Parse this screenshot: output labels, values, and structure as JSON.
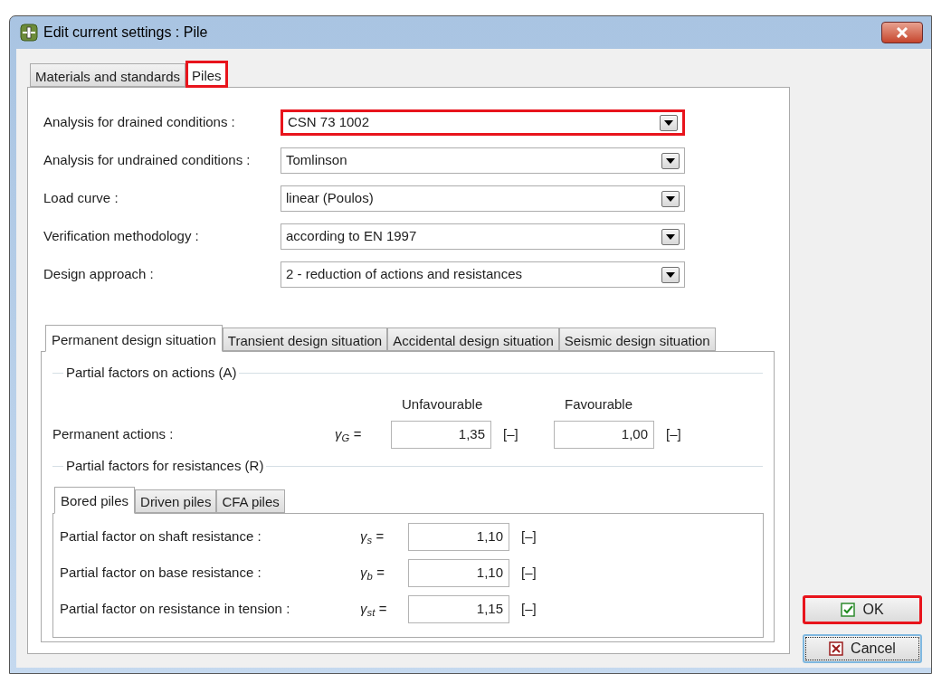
{
  "window": {
    "title": "Edit current settings : Pile"
  },
  "tabs": [
    {
      "label": "Materials and standards",
      "selected": false,
      "highlighted": false
    },
    {
      "label": "Piles",
      "selected": true,
      "highlighted": true
    }
  ],
  "settings": [
    {
      "label": "Analysis for drained conditions :",
      "value": "CSN 73 1002",
      "highlighted": true
    },
    {
      "label": "Analysis for undrained conditions :",
      "value": "Tomlinson",
      "highlighted": false
    },
    {
      "label": "Load curve :",
      "value": "linear (Poulos)",
      "highlighted": false
    },
    {
      "label": "Verification methodology :",
      "value": "according to EN 1997",
      "highlighted": false
    },
    {
      "label": "Design approach :",
      "value": "2 - reduction of actions and resistances",
      "highlighted": false
    }
  ],
  "situation_tabs": [
    {
      "label": "Permanent design situation",
      "selected": true
    },
    {
      "label": "Transient design situation",
      "selected": false
    },
    {
      "label": "Accidental design situation",
      "selected": false
    },
    {
      "label": "Seismic design situation",
      "selected": false
    }
  ],
  "actions_group": {
    "title": "Partial factors on actions (A)",
    "columns": [
      "Unfavourable",
      "Favourable"
    ],
    "rows": [
      {
        "label": "Permanent actions :",
        "symbol": "γ$_{G}$ =",
        "values": [
          {
            "value": "1,35",
            "unit": "[–]"
          },
          {
            "value": "1,00",
            "unit": "[–]"
          }
        ]
      }
    ]
  },
  "resistances_group": {
    "title": "Partial factors for resistances (R)",
    "tabs": [
      {
        "label": "Bored piles",
        "selected": true
      },
      {
        "label": "Driven piles",
        "selected": false
      },
      {
        "label": "CFA piles",
        "selected": false
      }
    ],
    "rows": [
      {
        "label": "Partial factor on shaft resistance :",
        "symbol": "γ$_{s}$ =",
        "value": "1,10",
        "unit": "[–]"
      },
      {
        "label": "Partial factor on base resistance :",
        "symbol": "γ$_{b}$ =",
        "value": "1,10",
        "unit": "[–]"
      },
      {
        "label": "Partial factor on resistance in tension :",
        "symbol": "γ$_{st}$ =",
        "value": "1,15",
        "unit": "[–]"
      }
    ]
  },
  "buttons": [
    {
      "label": "OK",
      "kind": "ok",
      "highlighted": true,
      "focused": false
    },
    {
      "label": "Cancel",
      "kind": "cancel",
      "highlighted": false,
      "focused": true
    }
  ]
}
